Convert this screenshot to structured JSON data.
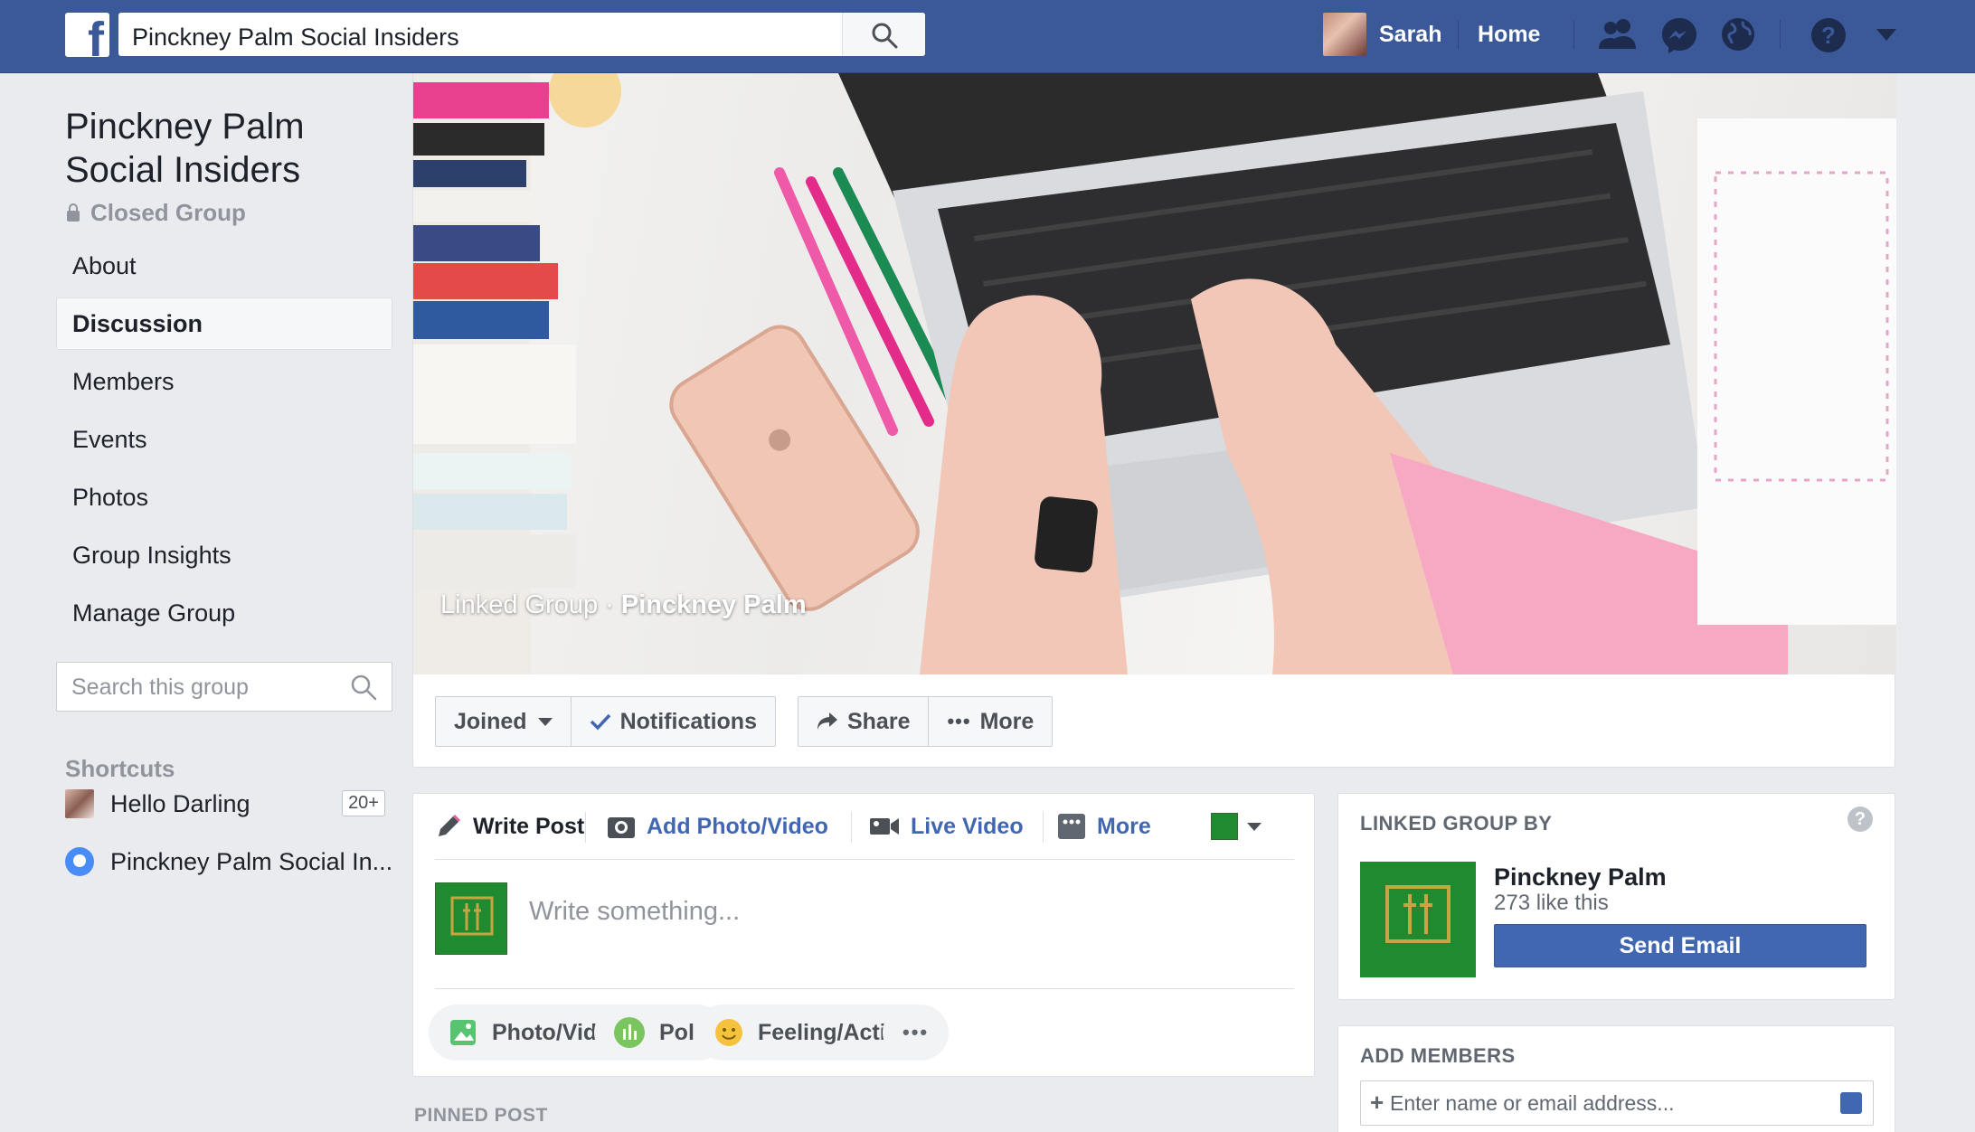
{
  "topbar": {
    "search_value": "Pinckney Palm Social Insiders",
    "user_name": "Sarah",
    "home_label": "Home",
    "brand_color": "#3b5998"
  },
  "group": {
    "title": "Pinckney Palm Social Insiders",
    "privacy": "Closed Group",
    "nav": [
      {
        "label": "About"
      },
      {
        "label": "Discussion",
        "active": true
      },
      {
        "label": "Members"
      },
      {
        "label": "Events"
      },
      {
        "label": "Photos"
      },
      {
        "label": "Group Insights"
      },
      {
        "label": "Manage Group"
      }
    ],
    "search_placeholder": "Search this group"
  },
  "shortcuts": {
    "heading": "Shortcuts",
    "items": [
      {
        "label": "Hello Darling",
        "badge": "20+"
      },
      {
        "label": "Pinckney Palm Social In..."
      }
    ]
  },
  "cover": {
    "caption_prefix": "Linked Group · ",
    "caption_page": "Pinckney Palm"
  },
  "actions": {
    "joined": "Joined",
    "notifications": "Notifications",
    "share": "Share",
    "more": "More"
  },
  "composer": {
    "tabs": {
      "write_post": "Write Post",
      "add_photo": "Add Photo/Video",
      "live_video": "Live Video",
      "more": "More"
    },
    "placeholder": "Write something...",
    "pills": {
      "photo_video": "Photo/Video",
      "poll": "Poll",
      "feeling": "Feeling/Activ...",
      "more": "•••"
    }
  },
  "pinned_label": "PINNED POST",
  "linked_group": {
    "heading": "LINKED GROUP BY",
    "page_name": "Pinckney Palm",
    "likes": "273 like this",
    "send_email": "Send Email"
  },
  "add_members": {
    "heading": "ADD MEMBERS",
    "placeholder": "Enter name or email address..."
  }
}
